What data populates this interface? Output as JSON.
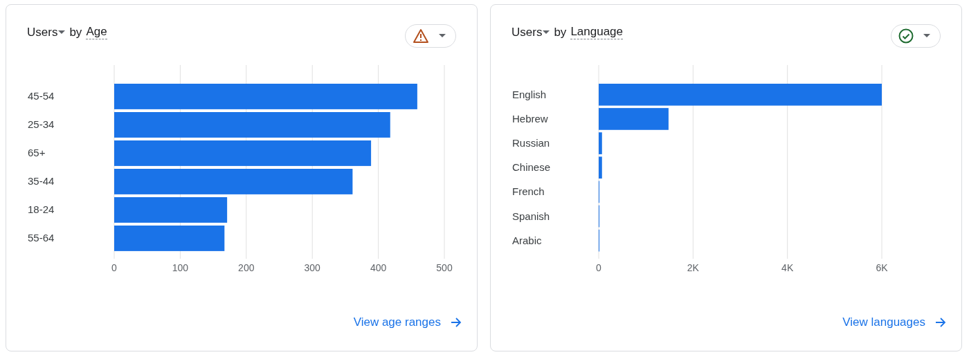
{
  "cards": [
    {
      "title": {
        "metric": "Users",
        "connector": "by",
        "dimension": "Age"
      },
      "status": {
        "kind": "warning"
      },
      "chart_data": {
        "type": "bar",
        "orientation": "horizontal",
        "grid": true,
        "categories": [
          "45-54",
          "25-34",
          "65+",
          "35-44",
          "18-24",
          "55-64"
        ],
        "series": [
          {
            "color": "#1a73e8",
            "values": [
              459,
              418,
              389,
              361,
              171,
              167
            ]
          }
        ],
        "xlim": [
          0,
          500
        ],
        "xticks": [
          0,
          100,
          200,
          300,
          400,
          500
        ]
      },
      "link": "View age ranges"
    },
    {
      "title": {
        "metric": "Users",
        "connector": "by",
        "dimension": "Language"
      },
      "status": {
        "kind": "ok"
      },
      "chart_data": {
        "type": "bar",
        "orientation": "horizontal",
        "grid": true,
        "categories": [
          "English",
          "Hebrew",
          "Russian",
          "Chinese",
          "French",
          "Spanish",
          "Arabic"
        ],
        "series": [
          {
            "color": "#1a73e8",
            "values": [
              6000,
              1480,
              70,
              70,
              10,
              10,
              10
            ]
          }
        ],
        "xlim": [
          0,
          6000
        ],
        "xticks": [
          {
            "value": 0,
            "label": "0"
          },
          {
            "value": 2000,
            "label": "2K"
          },
          {
            "value": 4000,
            "label": "4K"
          },
          {
            "value": 6000,
            "label": "6K"
          }
        ]
      },
      "link": "View languages"
    }
  ]
}
